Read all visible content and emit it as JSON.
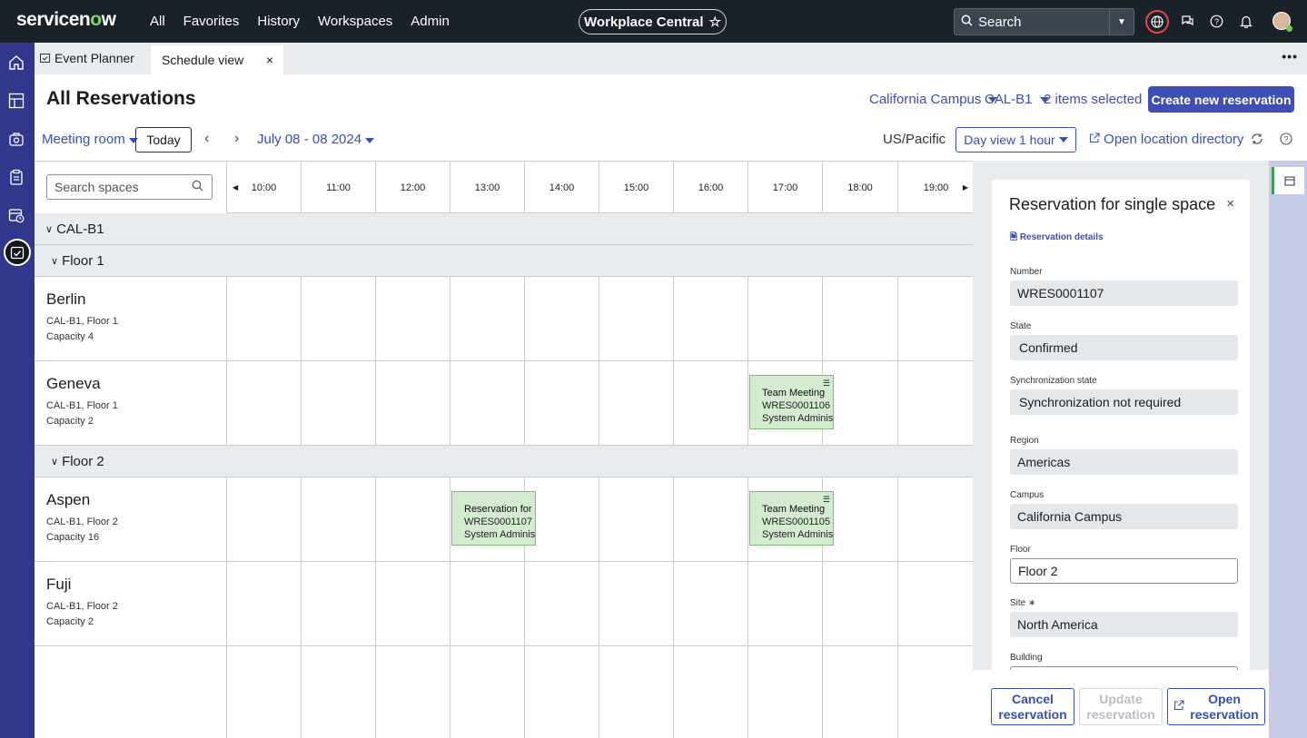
{
  "topnav": {
    "logo_pre": "servicen",
    "logo_o": "o",
    "logo_post": "w",
    "links": [
      "All",
      "Favorites",
      "History",
      "Workspaces",
      "Admin"
    ],
    "workspace_pill": "Workplace Central",
    "search_placeholder": "Search"
  },
  "tabs": {
    "tab1": "Event Planner",
    "tab2": "Schedule view",
    "more": "•••"
  },
  "header": {
    "title": "All Reservations",
    "filter_campus": "California Campus",
    "filter_building": "CAL-B1",
    "filter_items": "2 items selected",
    "create_button": "Create new reservation"
  },
  "toolbar": {
    "space_type": "Meeting room",
    "today_button": "Today",
    "date_range": "July 08 - 08 2024",
    "timezone": "US/Pacific",
    "view_button": "Day view 1 hour",
    "open_directory": "Open location directory"
  },
  "grid": {
    "search_placeholder": "Search spaces",
    "hours": [
      "10:00",
      "11:00",
      "12:00",
      "13:00",
      "14:00",
      "15:00",
      "16:00",
      "17:00",
      "18:00",
      "19:00"
    ],
    "building": "CAL-B1",
    "floors": [
      {
        "name": "Floor 1",
        "rooms": [
          {
            "name": "Berlin",
            "location": "CAL-B1, Floor 1",
            "capacity": "Capacity 4"
          },
          {
            "name": "Geneva",
            "location": "CAL-B1, Floor 1",
            "capacity": "Capacity 2"
          }
        ]
      },
      {
        "name": "Floor 2",
        "rooms": [
          {
            "name": "Aspen",
            "location": "CAL-B1, Floor 2",
            "capacity": "Capacity 16"
          },
          {
            "name": "Fuji",
            "location": "CAL-B1, Floor 2",
            "capacity": "Capacity 2"
          }
        ]
      }
    ],
    "events": [
      {
        "title": "Team Meeting",
        "number": "WRES0001106",
        "owner": "System Adminis..."
      },
      {
        "title": "Reservation for ...",
        "number": "WRES0001107",
        "owner": "System Adminis..."
      },
      {
        "title": "Team Meeting",
        "number": "WRES0001105",
        "owner": "System Adminis..."
      }
    ]
  },
  "panel": {
    "title": "Reservation for single space",
    "details_link": "Reservation details",
    "fields": [
      {
        "label": "Number",
        "value": "WRES0001107"
      },
      {
        "label": "State",
        "value": "Confirmed"
      },
      {
        "label": "Synchronization state",
        "value": "Synchronization not required"
      },
      {
        "label": "Region",
        "value": "Americas"
      },
      {
        "label": "Campus",
        "value": "California Campus"
      },
      {
        "label": "Floor",
        "value": "Floor 2"
      },
      {
        "label": "Site ∗",
        "value": "North America"
      },
      {
        "label": "Building",
        "value": ""
      }
    ],
    "cancel_button_l1": "Cancel",
    "cancel_button_l2": "reservation",
    "update_button_l1": "Update",
    "update_button_l2": "reservation",
    "open_button_l1": "Open",
    "open_button_l2": "reservation"
  },
  "colors": {
    "nav_bg": "#1a2129",
    "rail_bg": "#31378b",
    "accent": "#3f4eb4",
    "event_bg": "#d3ecd0"
  }
}
